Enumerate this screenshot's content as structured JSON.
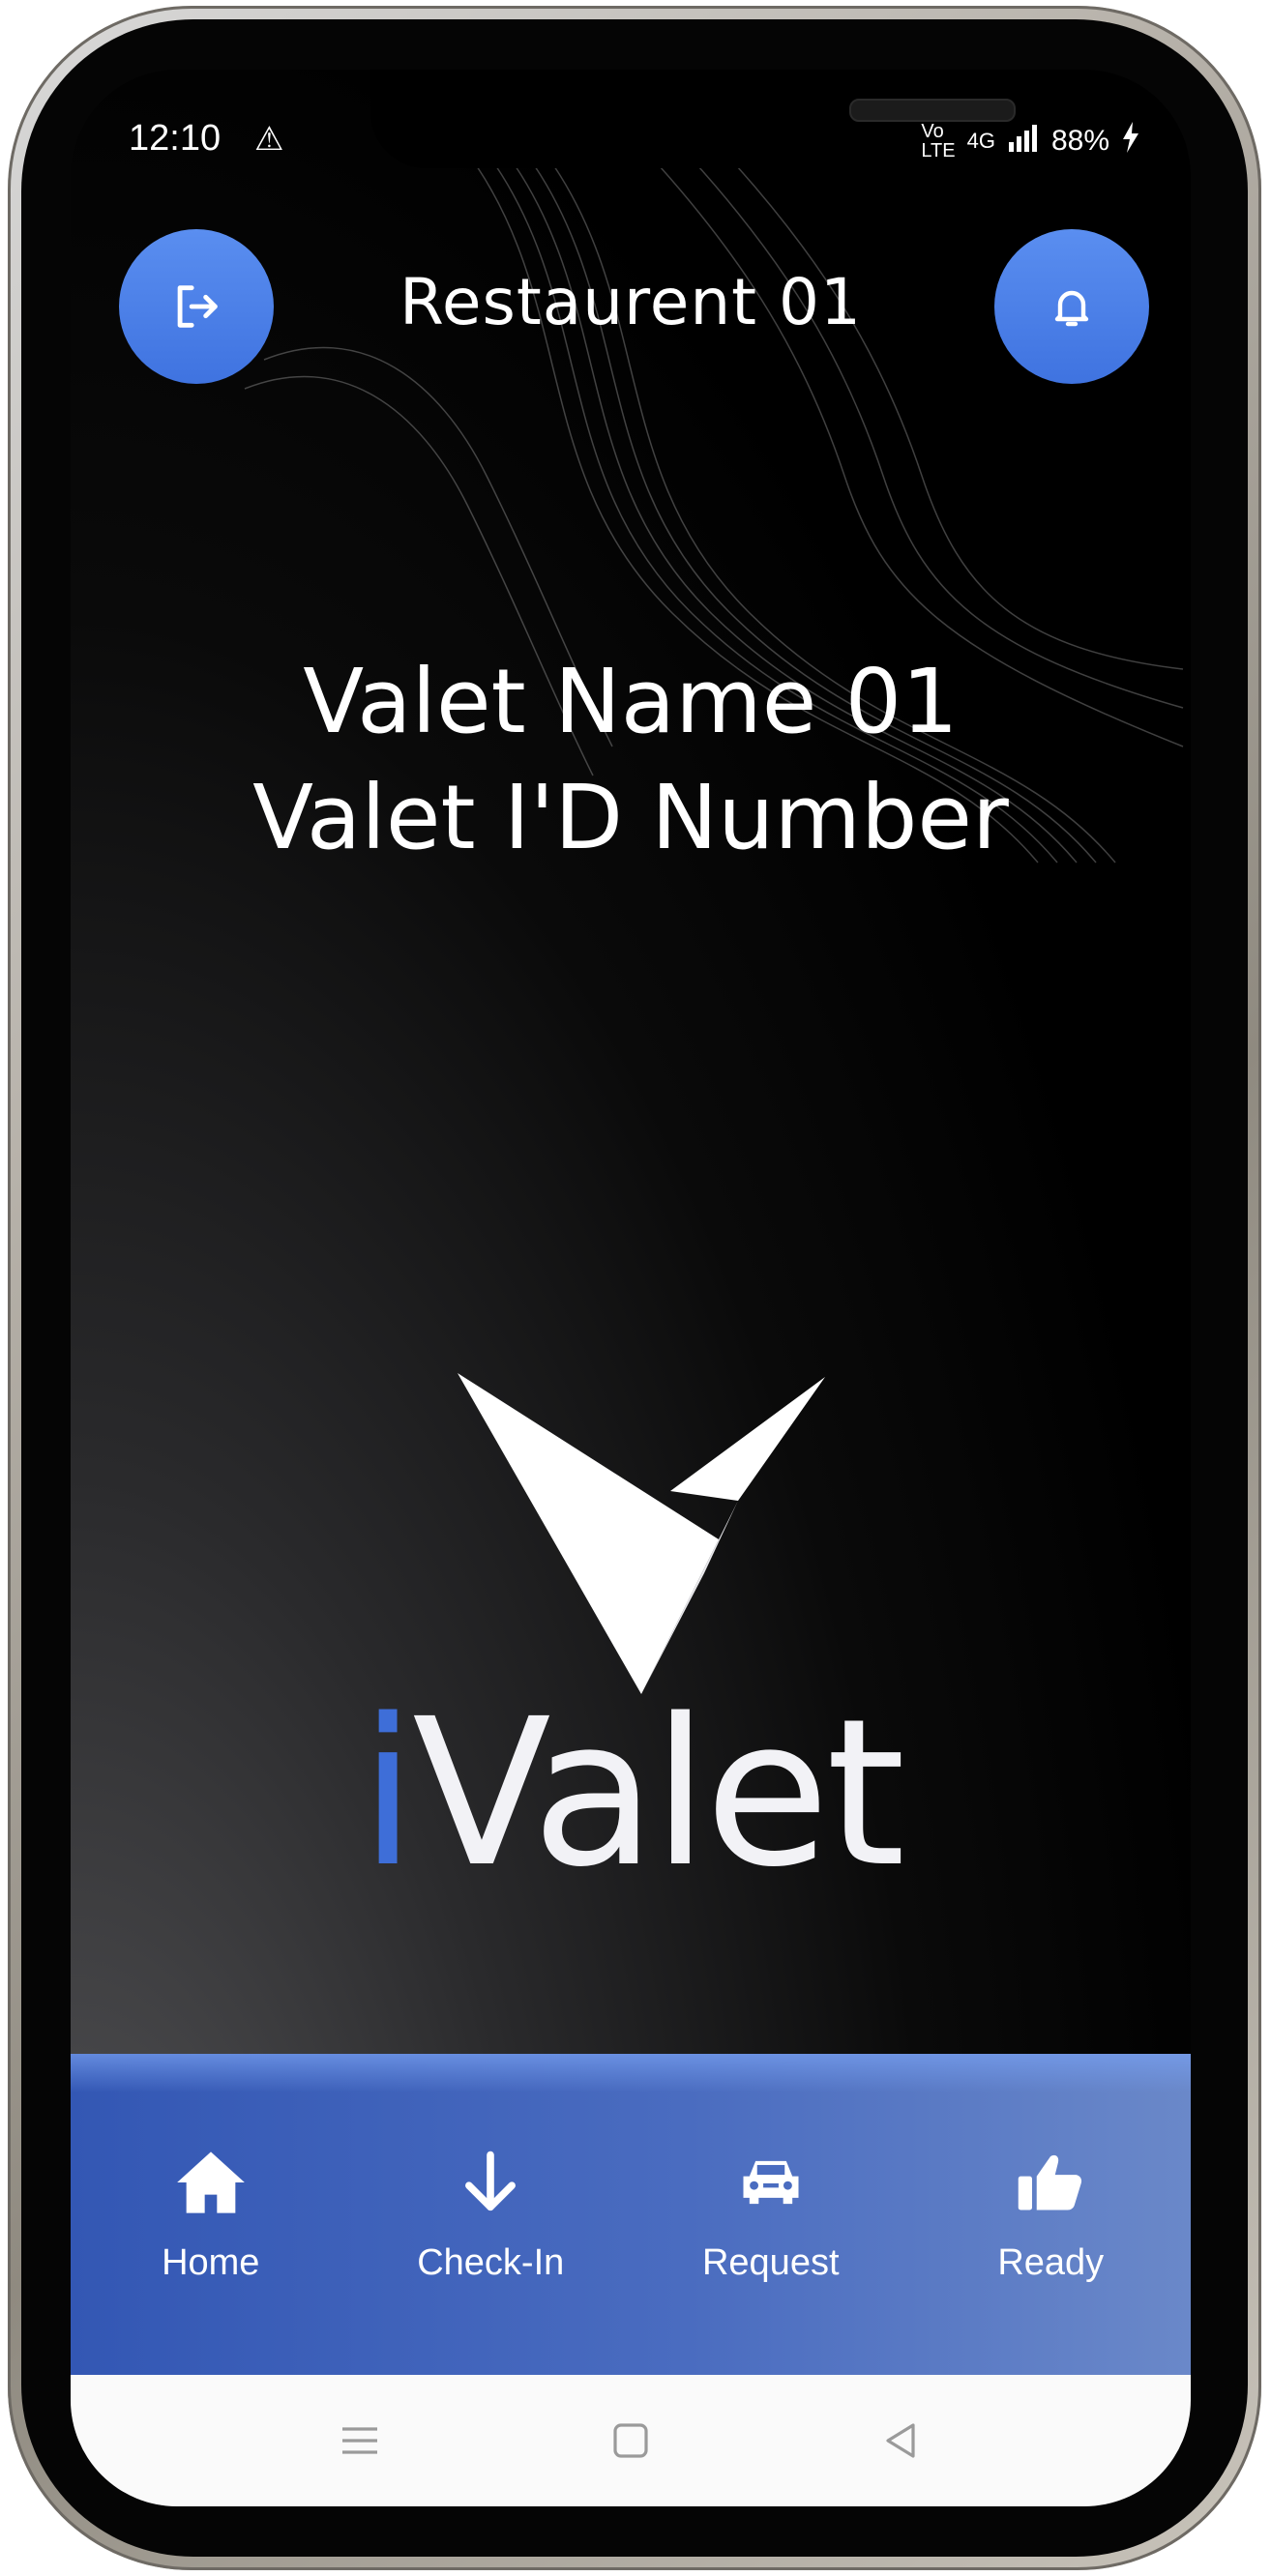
{
  "status_bar": {
    "time": "12:10",
    "network": "4G",
    "battery": "88%"
  },
  "header": {
    "title": "Restaurent 01",
    "left_icon": "exit-icon",
    "right_icon": "bell-icon"
  },
  "valet": {
    "name": "Valet Name 01",
    "id_label": "Valet I'D Number"
  },
  "logo": {
    "prefix": "i",
    "suffix": "Valet"
  },
  "tabs": [
    {
      "label": "Home",
      "icon": "home-icon"
    },
    {
      "label": "Check-In",
      "icon": "arrow-down-icon"
    },
    {
      "label": "Request",
      "icon": "car-icon"
    },
    {
      "label": "Ready",
      "icon": "thumbs-up-icon"
    }
  ],
  "colors": {
    "accent": "#3f73e0",
    "tabbar_start": "#3357b4",
    "tabbar_end": "#6a88c9"
  }
}
